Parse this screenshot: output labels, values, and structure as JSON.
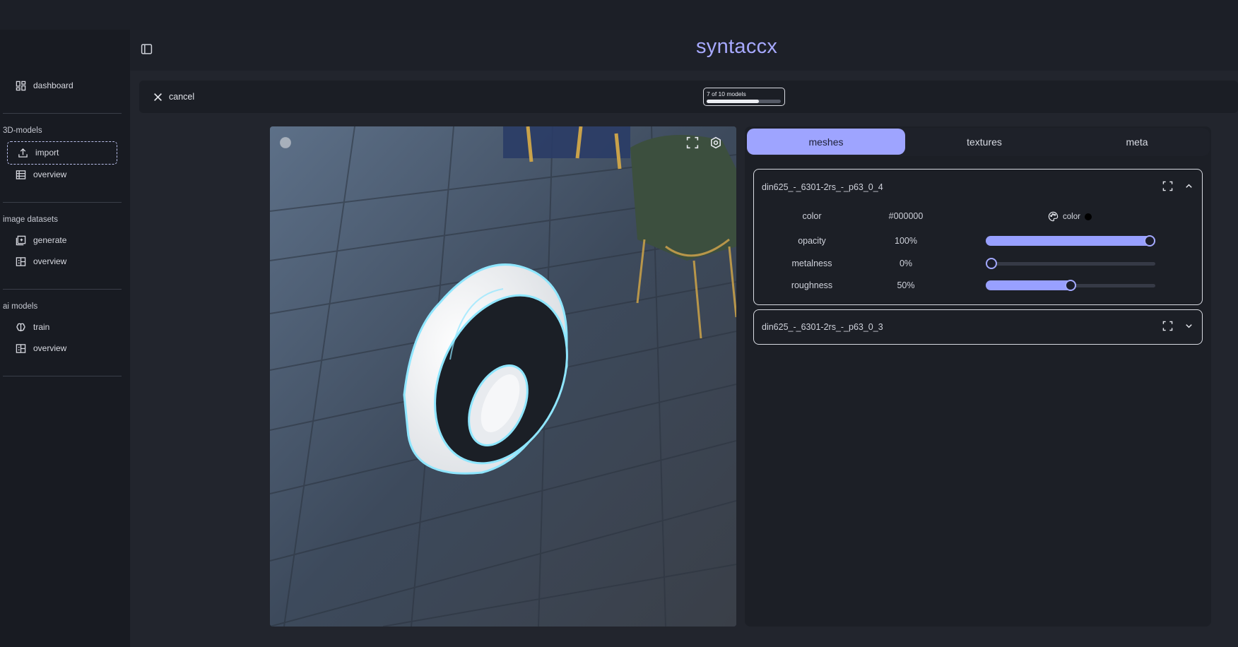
{
  "app": {
    "brand": "syntaccx"
  },
  "sidebar": {
    "dashboard": "dashboard",
    "sections": [
      {
        "label": "3D-models",
        "items": [
          "import",
          "overview"
        ]
      },
      {
        "label": "image datasets",
        "items": [
          "generate",
          "overview"
        ]
      },
      {
        "label": "ai models",
        "items": [
          "train",
          "overview"
        ]
      }
    ]
  },
  "toolbar": {
    "cancel_label": "cancel",
    "progress_text": "7 of 10 models",
    "progress_fraction": 0.7
  },
  "tabs": [
    {
      "label": "meshes",
      "active": true
    },
    {
      "label": "textures",
      "active": false
    },
    {
      "label": "meta",
      "active": false
    }
  ],
  "meshes": [
    {
      "name": "din625_-_6301-2rs_-_p63_0_4",
      "expanded": true,
      "color": {
        "label": "color",
        "value": "#000000",
        "picker_label": "color"
      },
      "properties": [
        {
          "label": "opacity",
          "value": "100%",
          "fraction": 1.0
        },
        {
          "label": "metalness",
          "value": "0%",
          "fraction": 0.0
        },
        {
          "label": "roughness",
          "value": "50%",
          "fraction": 0.5
        }
      ]
    },
    {
      "name": "din625_-_6301-2rs_-_p63_0_3",
      "expanded": false
    }
  ],
  "colors": {
    "accent": "#9ea4ff",
    "brand": "#a7a9ff",
    "background": "#22252d"
  },
  "icons": [
    "sidebar-toggle-icon",
    "dashboard-icon",
    "upload-icon",
    "table-icon",
    "image-add-icon",
    "gallery-icon",
    "brain-icon",
    "close-icon",
    "globe-icon",
    "fullscreen-icon",
    "settings-icon",
    "expand-icon",
    "chevron-up-icon",
    "chevron-down-icon",
    "palette-icon"
  ]
}
